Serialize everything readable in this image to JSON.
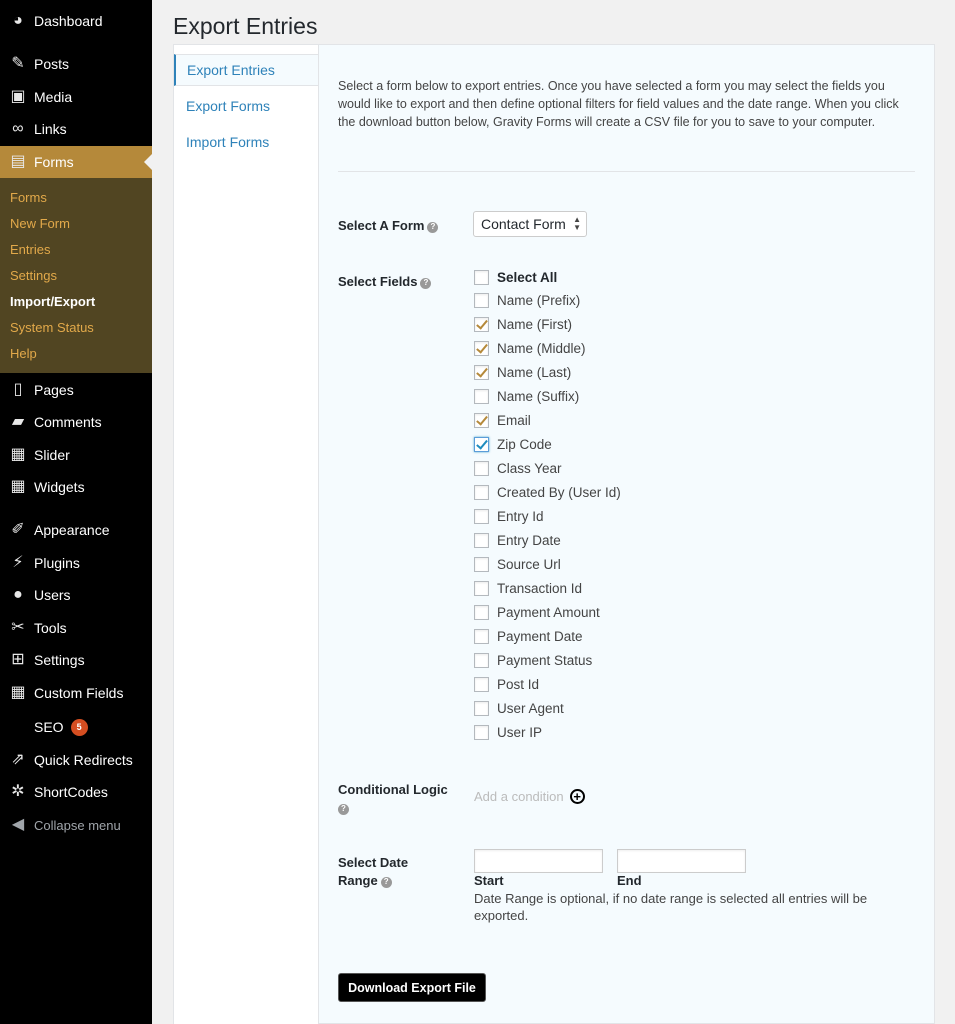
{
  "sidebar": {
    "menu": [
      {
        "label": "Dashboard",
        "icon": "dashboard-icon",
        "glyph": "◕"
      },
      {
        "label": "Posts",
        "icon": "pin-icon",
        "glyph": "✎"
      },
      {
        "label": "Media",
        "icon": "media-icon",
        "glyph": "▣"
      },
      {
        "label": "Links",
        "icon": "link-icon",
        "glyph": "∞"
      },
      {
        "label": "Forms",
        "icon": "forms-icon",
        "glyph": "▤"
      },
      {
        "label": "Pages",
        "icon": "pages-icon",
        "glyph": "▯"
      },
      {
        "label": "Comments",
        "icon": "comments-icon",
        "glyph": "▰"
      },
      {
        "label": "Slider",
        "icon": "slider-icon",
        "glyph": "▦"
      },
      {
        "label": "Widgets",
        "icon": "widgets-icon",
        "glyph": "▦"
      },
      {
        "label": "Appearance",
        "icon": "appearance-icon",
        "glyph": "✐"
      },
      {
        "label": "Plugins",
        "icon": "plugins-icon",
        "glyph": "⚡"
      },
      {
        "label": "Users",
        "icon": "users-icon",
        "glyph": "●"
      },
      {
        "label": "Tools",
        "icon": "tools-icon",
        "glyph": "✂"
      },
      {
        "label": "Settings",
        "icon": "settings-icon",
        "glyph": "⊞"
      },
      {
        "label": "Custom Fields",
        "icon": "custom-fields-icon",
        "glyph": "▦"
      },
      {
        "label": "SEO",
        "icon": "seo-icon",
        "glyph": "",
        "badge": "5"
      },
      {
        "label": "Quick Redirects",
        "icon": "redirect-icon",
        "glyph": "⇗"
      },
      {
        "label": "ShortCodes",
        "icon": "gear-icon",
        "glyph": "✲"
      },
      {
        "label": "Collapse menu",
        "icon": "collapse-icon",
        "glyph": "◀"
      }
    ],
    "submenu": [
      "Forms",
      "New Form",
      "Entries",
      "Settings",
      "Import/Export",
      "System Status",
      "Help"
    ]
  },
  "page": {
    "title": "Export Entries"
  },
  "tabs": [
    "Export Entries",
    "Export Forms",
    "Import Forms"
  ],
  "intro": "Select a form below to export entries. Once you have selected a form you may select the fields you would like to export and then define optional filters for field values and the date range. When you click the download button below, Gravity Forms will create a CSV file for you to save to your computer.",
  "form_select": {
    "label": "Select A Form",
    "value": "Contact Form"
  },
  "fields": {
    "label": "Select Fields",
    "items": [
      {
        "label": "Select All",
        "checked": false
      },
      {
        "label": "Name (Prefix)",
        "checked": false
      },
      {
        "label": "Name (First)",
        "checked": true
      },
      {
        "label": "Name (Middle)",
        "checked": true
      },
      {
        "label": "Name (Last)",
        "checked": true
      },
      {
        "label": "Name (Suffix)",
        "checked": false
      },
      {
        "label": "Email",
        "checked": true
      },
      {
        "label": "Zip Code",
        "checked": true
      },
      {
        "label": "Class Year",
        "checked": false
      },
      {
        "label": "Created By (User Id)",
        "checked": false
      },
      {
        "label": "Entry Id",
        "checked": false
      },
      {
        "label": "Entry Date",
        "checked": false
      },
      {
        "label": "Source Url",
        "checked": false
      },
      {
        "label": "Transaction Id",
        "checked": false
      },
      {
        "label": "Payment Amount",
        "checked": false
      },
      {
        "label": "Payment Date",
        "checked": false
      },
      {
        "label": "Payment Status",
        "checked": false
      },
      {
        "label": "Post Id",
        "checked": false
      },
      {
        "label": "User Agent",
        "checked": false
      },
      {
        "label": "User IP",
        "checked": false
      }
    ]
  },
  "conditional": {
    "label": "Conditional Logic",
    "placeholder": "Add a condition"
  },
  "date_range": {
    "label_line1": "Select Date",
    "label_line2": "Range",
    "start_label": "Start",
    "end_label": "End",
    "start_value": "",
    "end_value": "",
    "note": "Date Range is optional, if no date range is selected all entries will be exported."
  },
  "download_label": "Download Export File",
  "help_glyph": "?"
}
